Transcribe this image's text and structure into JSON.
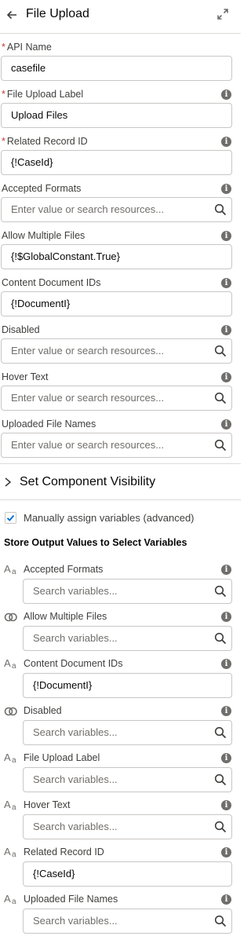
{
  "header": {
    "title": "File Upload"
  },
  "fields": [
    {
      "key": "api_name",
      "label": "API Name",
      "required": "*",
      "value": "casefile"
    },
    {
      "key": "file_upload_label",
      "label": "File Upload Label",
      "required": "*",
      "value": "Upload Files"
    },
    {
      "key": "related_record_id",
      "label": "Related Record ID",
      "required": "*",
      "value": "{!CaseId}"
    },
    {
      "key": "accepted_formats",
      "label": "Accepted Formats",
      "placeholder": "Enter value or search resources..."
    },
    {
      "key": "allow_multiple_files",
      "label": "Allow Multiple Files",
      "value": "{!$GlobalConstant.True}"
    },
    {
      "key": "content_document_ids",
      "label": "Content Document IDs",
      "value": "{!DocumentI}"
    },
    {
      "key": "disabled",
      "label": "Disabled",
      "placeholder": "Enter value or search resources..."
    },
    {
      "key": "hover_text",
      "label": "Hover Text",
      "placeholder": "Enter value or search resources..."
    },
    {
      "key": "uploaded_file_names",
      "label": "Uploaded File Names",
      "placeholder": "Enter value or search resources..."
    }
  ],
  "visibility_section": {
    "title": "Set Component Visibility"
  },
  "manual_assign": {
    "label": "Manually assign variables (advanced)",
    "checked": true
  },
  "output": {
    "title": "Store Output Values to Select Variables",
    "items": [
      {
        "label": "Accepted Formats",
        "type_icon": "text-type-icon",
        "placeholder": "Search variables..."
      },
      {
        "label": "Allow Multiple Files",
        "type_icon": "boolean-type-icon",
        "placeholder": "Search variables..."
      },
      {
        "label": "Content Document IDs",
        "type_icon": "text-type-icon",
        "value": "{!DocumentI}"
      },
      {
        "label": "Disabled",
        "type_icon": "boolean-type-icon",
        "placeholder": "Search variables..."
      },
      {
        "label": "File Upload Label",
        "type_icon": "text-type-icon",
        "placeholder": "Search variables..."
      },
      {
        "label": "Hover Text",
        "type_icon": "text-type-icon",
        "placeholder": "Search variables..."
      },
      {
        "label": "Related Record ID",
        "type_icon": "text-type-icon",
        "value": "{!CaseId}"
      },
      {
        "label": "Uploaded File Names",
        "type_icon": "text-type-icon",
        "placeholder": "Search variables..."
      }
    ]
  },
  "colors": {
    "required": "#c23934",
    "border": "#c9c7c5",
    "icon": "#706e6b",
    "text": "#3e3e3c"
  }
}
